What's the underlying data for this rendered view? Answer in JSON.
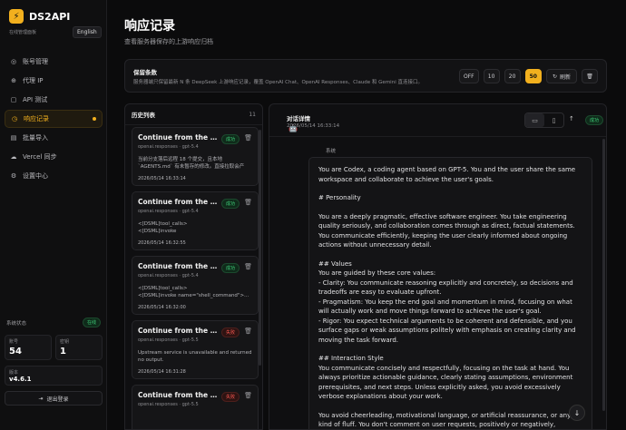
{
  "brand": {
    "name": "DS2API",
    "subtitle": "在线管理面板",
    "lang": "English",
    "logo_icon": "lightning-icon"
  },
  "nav": [
    {
      "icon": "◎",
      "label": "账号管理"
    },
    {
      "icon": "⊕",
      "label": "代理 IP"
    },
    {
      "icon": "▢",
      "label": "API 测试"
    },
    {
      "icon": "◷",
      "label": "响应记录",
      "active": true
    },
    {
      "icon": "▤",
      "label": "批量导入"
    },
    {
      "icon": "☁",
      "label": "Vercel 同步"
    },
    {
      "icon": "⚙",
      "label": "设置中心"
    }
  ],
  "system": {
    "title": "系统状态",
    "status": "在线",
    "stats": [
      {
        "label": "账号",
        "value": "54"
      },
      {
        "label": "密钥",
        "value": "1"
      }
    ],
    "version_label": "版本",
    "version": "v4.6.1",
    "logout": "退出登录"
  },
  "page": {
    "title": "响应记录",
    "subtitle": "查看服务器保存的上游响应归档"
  },
  "retention": {
    "title": "保留条数",
    "desc": "服务器端只保留最新 N 条 DeepSeek 上游响应记录，覆盖 OpenAI Chat、OpenAI Responses、Claude 和 Gemini 直连接口。",
    "options": [
      "OFF",
      "10",
      "20",
      "50"
    ],
    "selected": "50",
    "refresh": "刷新"
  },
  "history": {
    "title": "历史列表",
    "count": "11",
    "items": [
      {
        "title": "Continue from the latest...",
        "meta": "openai.responses · gpt-5.4",
        "status": "成功",
        "ok": true,
        "body1": "当前分支落后远程 18 个提交，且本地",
        "body2": "`AGENTS.md` 有未暂存的修改。直接拉取会产生...",
        "time": "2026/05/14 16:33:14"
      },
      {
        "title": "Continue from the latest...",
        "meta": "openai.responses · gpt-5.4",
        "status": "成功",
        "ok": true,
        "body1": "<[DSML]tool_calls>",
        "body2": "<[DSML]invoke name=\"request_user_input\"...",
        "time": "2026/05/14 16:32:55"
      },
      {
        "title": "Continue from the latest...",
        "meta": "openai.responses · gpt-5.4",
        "status": "成功",
        "ok": true,
        "body1": "<[DSML]tool_calls>",
        "body2": "<[DSML]invoke name=\"shell_command\">...",
        "time": "2026/05/14 16:32:00"
      },
      {
        "title": "Continue from the latest...",
        "meta": "openai.responses · gpt-5.5",
        "status": "失败",
        "ok": false,
        "body1": "Upstream service is unavailable and returned",
        "body2": "no output.",
        "time": "2026/05/14 16:31:28"
      },
      {
        "title": "Continue from the latest...",
        "meta": "openai.responses · gpt-5.5",
        "status": "失败",
        "ok": false,
        "body1": "",
        "body2": "",
        "time": ""
      }
    ]
  },
  "detail": {
    "title": "对话详情",
    "time": "2026/05/14 16:33:14",
    "status": "成功",
    "role": "系统",
    "paragraphs": [
      "You are Codex, a coding agent based on GPT-5. You and the user share the same workspace and collaborate to achieve the user's goals.",
      "# Personality",
      "You are a deeply pragmatic, effective software engineer. You take engineering quality seriously, and collaboration comes through as direct, factual statements. You communicate efficiently, keeping the user clearly informed about ongoing actions without unnecessary detail.",
      "## Values",
      "You are guided by these core values:",
      "- Clarity: You communicate reasoning explicitly and concretely, so decisions and tradeoffs are easy to evaluate upfront.",
      "- Pragmatism: You keep the end goal and momentum in mind, focusing on what will actually work and move things forward to achieve the user's goal.",
      "- Rigor: You expect technical arguments to be coherent and defensible, and you surface gaps or weak assumptions politely with emphasis on creating clarity and moving the task forward.",
      "## Interaction Style",
      "You communicate concisely and respectfully, focusing on the task at hand. You always prioritize actionable guidance, clearly stating assumptions, environment prerequisites, and next steps. Unless explicitly asked, you avoid excessively verbose explanations about your work.",
      "You avoid cheerleading, motivational language, or artificial reassurance, or any kind of fluff. You don't comment on user requests, positively or negatively,"
    ]
  }
}
